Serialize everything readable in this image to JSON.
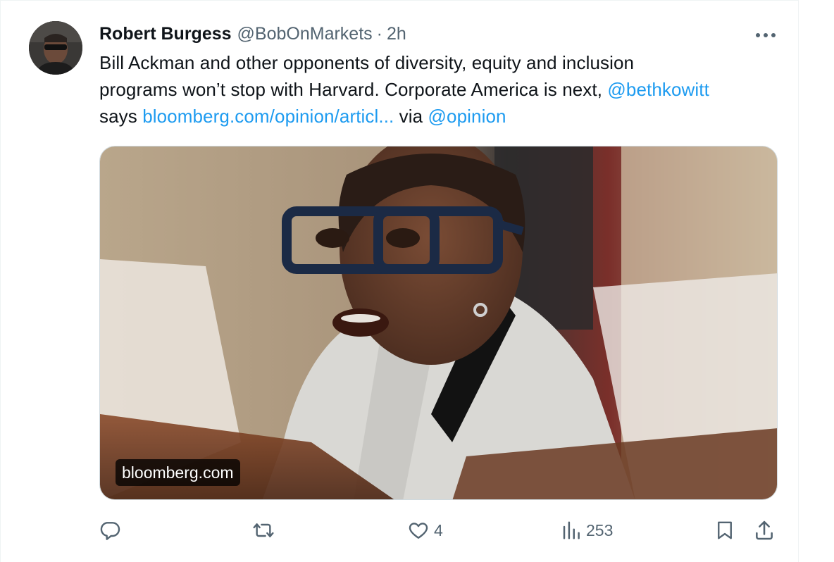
{
  "tweet": {
    "author": {
      "display_name": "Robert Burgess",
      "handle": "@BobOnMarkets",
      "separator": "·",
      "time": "2h"
    },
    "text": {
      "line1": "Bill Ackman and other opponents of diversity, equity and inclusion",
      "line2_text": "programs won’t stop with Harvard. Corporate America is next, ",
      "line2_mention": "@bethkowitt",
      "line3_says": "says ",
      "line3_link": "bloomberg.com/opinion/articl...",
      "line3_via": " via ",
      "line3_mention": "@opinion"
    },
    "media": {
      "domain_label": "bloomberg.com"
    },
    "actions": {
      "reply": {
        "icon": "reply-icon",
        "count": ""
      },
      "retweet": {
        "icon": "retweet-icon",
        "count": ""
      },
      "like": {
        "icon": "heart-icon",
        "count": "4"
      },
      "views": {
        "icon": "views-chart-icon",
        "count": "253"
      },
      "bookmark": {
        "icon": "bookmark-icon"
      },
      "share": {
        "icon": "share-icon"
      }
    }
  },
  "colors": {
    "link": "#1d9bf0",
    "secondary_text": "#536471",
    "primary_text": "#0f1419"
  }
}
